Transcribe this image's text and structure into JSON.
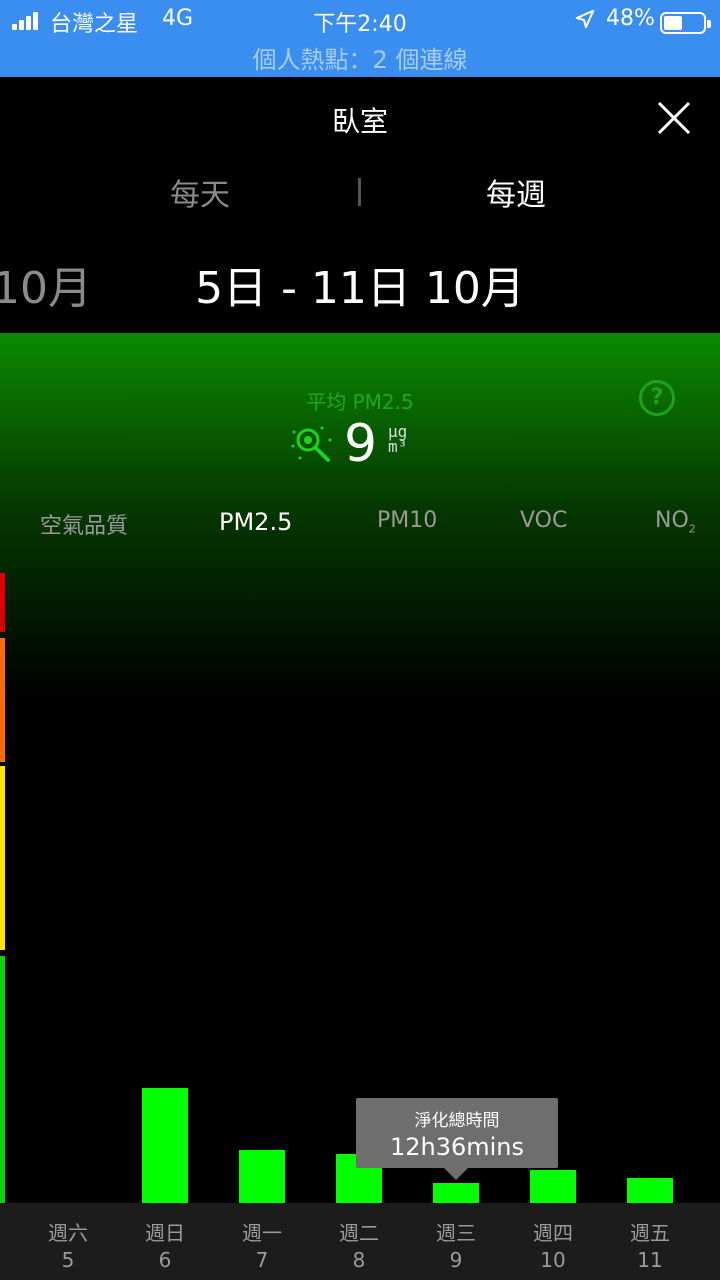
{
  "status_bar": {
    "carrier": "台灣之星",
    "network": "4G",
    "time": "下午2:40",
    "battery": "48%",
    "battery_level": 0.48,
    "hotspot": "個人熱點：2 個連線"
  },
  "header": {
    "title": "臥室",
    "tabs": {
      "daily": "每天",
      "weekly": "每週"
    },
    "prev_date": "10月",
    "date_range": "5日 - 11日 10月"
  },
  "summary": {
    "avg_label": "平均 PM2.5",
    "value": "9",
    "unit_top": "μg",
    "unit_bottom": "m³"
  },
  "metrics": {
    "aqi": "空氣品質",
    "pm25": "PM2.5",
    "pm10": "PM10",
    "voc": "VOC",
    "no2": "NO",
    "no2_sub": "2"
  },
  "colors": {
    "bar": "#00ff00",
    "scale": [
      "#e00000",
      "#ff6a00",
      "#ffe600",
      "#10d010"
    ]
  },
  "tooltip": {
    "title": "淨化總時間",
    "value": "12h36mins"
  },
  "chart_data": {
    "type": "bar",
    "categories": [
      "週六 5",
      "週日 6",
      "週一 7",
      "週二 8",
      "週三 9",
      "週四 10",
      "週五 11"
    ],
    "values": [
      0,
      23,
      10.5,
      9.8,
      4,
      6.5,
      5
    ]
  },
  "days": [
    {
      "w": "週六",
      "d": "5"
    },
    {
      "w": "週日",
      "d": "6"
    },
    {
      "w": "週一",
      "d": "7"
    },
    {
      "w": "週二",
      "d": "8"
    },
    {
      "w": "週三",
      "d": "9"
    },
    {
      "w": "週四",
      "d": "10"
    },
    {
      "w": "週五",
      "d": "11"
    }
  ]
}
